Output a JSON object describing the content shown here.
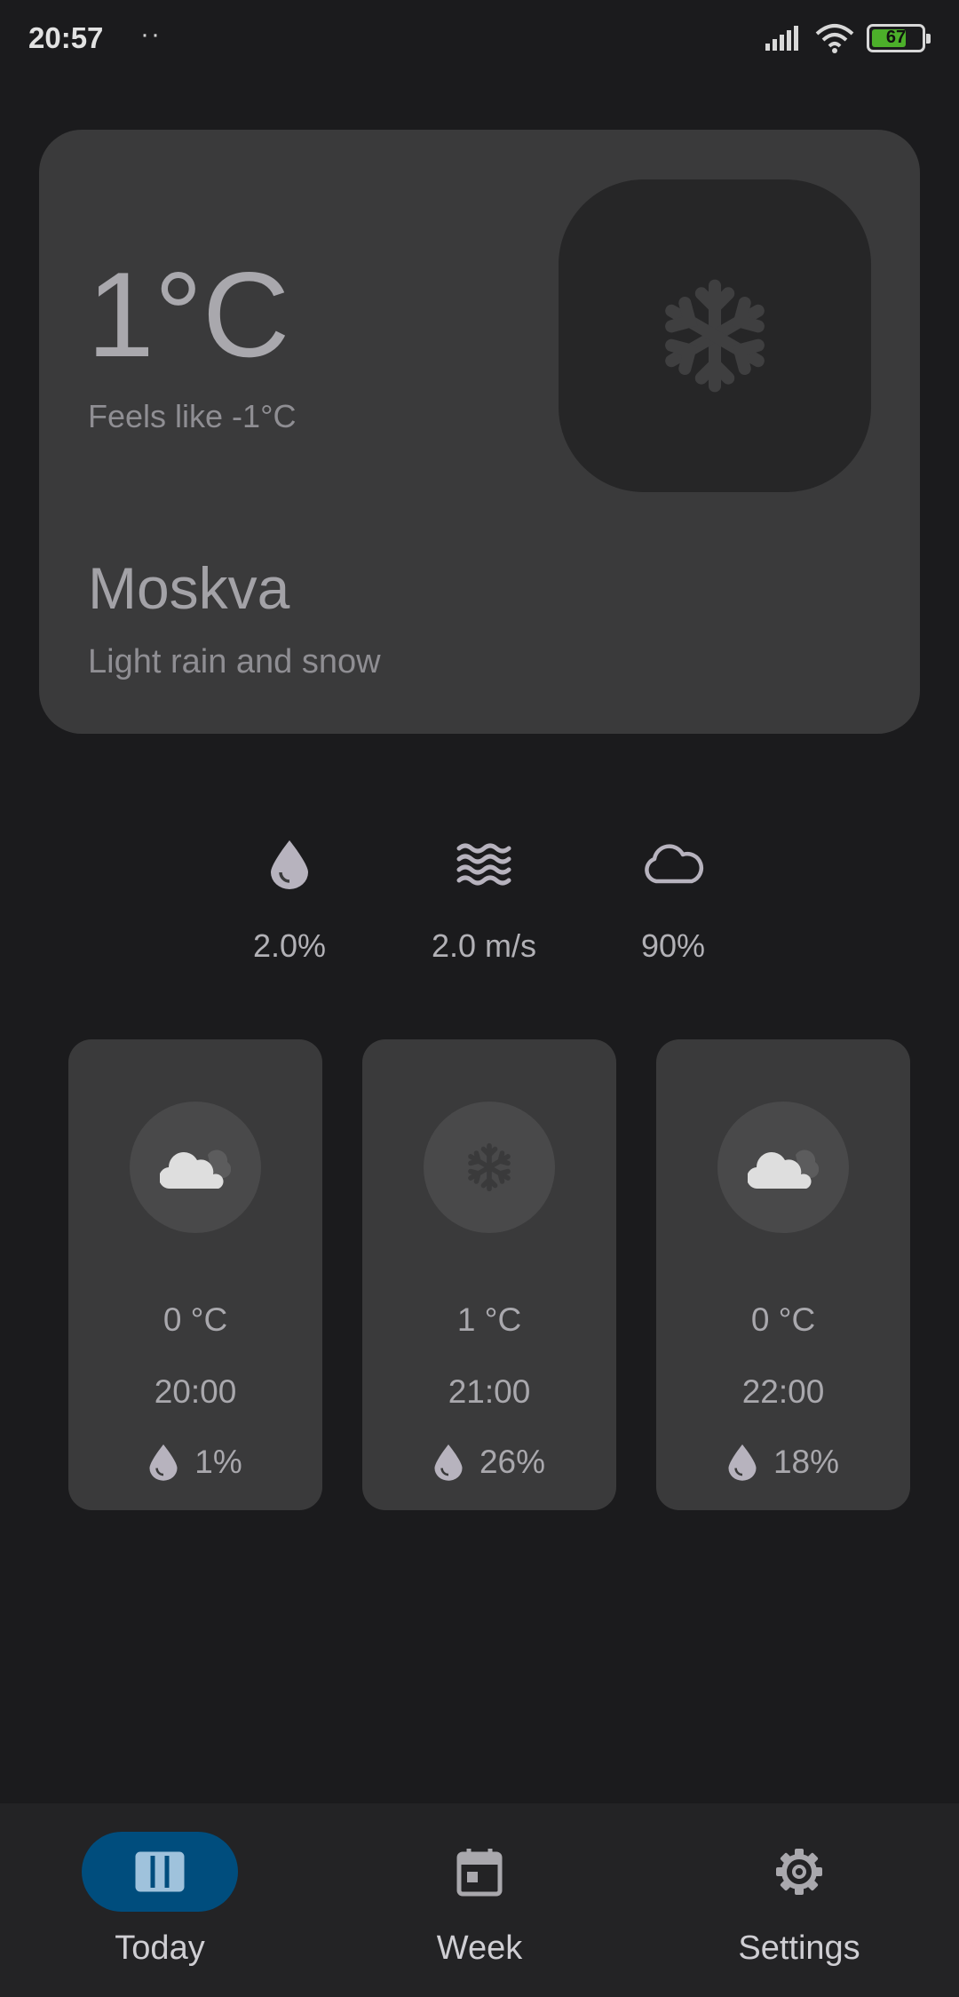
{
  "status_bar": {
    "time": "20:57",
    "dots": "··",
    "battery": "67"
  },
  "current": {
    "temperature": "1°C",
    "feels_like": "Feels like -1°C",
    "city": "Moskva",
    "condition": "Light rain and snow",
    "icon": "snowflake-icon"
  },
  "metrics": [
    {
      "icon": "raindrop-icon",
      "value": "2.0%"
    },
    {
      "icon": "wind-waves-icon",
      "value": "2.0 m/s"
    },
    {
      "icon": "cloud-outline-icon",
      "value": "90%"
    }
  ],
  "hourly": [
    {
      "icon": "cloud-icon",
      "temp": "0 °C",
      "time": "20:00",
      "rain": "1%"
    },
    {
      "icon": "snowflake-icon",
      "temp": "1 °C",
      "time": "21:00",
      "rain": "26%"
    },
    {
      "icon": "cloud-icon",
      "temp": "0 °C",
      "time": "22:00",
      "rain": "18%"
    }
  ],
  "nav": [
    {
      "label": "Today",
      "icon": "view-columns-icon",
      "active": true
    },
    {
      "label": "Week",
      "icon": "calendar-icon",
      "active": false
    },
    {
      "label": "Settings",
      "icon": "gear-icon",
      "active": false
    }
  ],
  "colors": {
    "accent": "#004d7d",
    "background": "#1b1b1d",
    "card": "#3a3a3b"
  }
}
